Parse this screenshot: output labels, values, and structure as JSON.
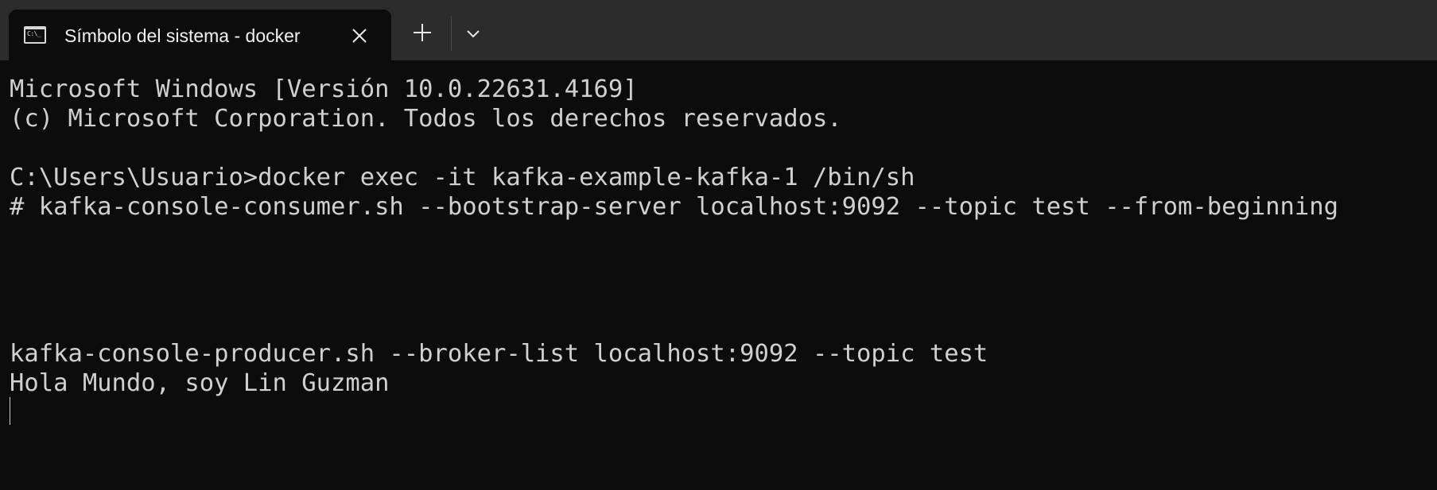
{
  "tab": {
    "title": "Símbolo del sistema - docker",
    "icon": "cmd-prompt-icon",
    "icon_text": "C:\\_"
  },
  "controls": {
    "close_icon": "close-icon",
    "new_tab_icon": "plus-icon",
    "dropdown_icon": "chevron-down-icon"
  },
  "terminal": {
    "lines": [
      "Microsoft Windows [Versión 10.0.22631.4169]",
      "(c) Microsoft Corporation. Todos los derechos reservados.",
      "",
      "C:\\Users\\Usuario>docker exec -it kafka-example-kafka-1 /bin/sh",
      "# kafka-console-consumer.sh --bootstrap-server localhost:9092 --topic test --from-beginning",
      "",
      "",
      "",
      "",
      "kafka-console-producer.sh --broker-list localhost:9092 --topic test",
      "Hola Mundo, soy Lin Guzman"
    ]
  },
  "colors": {
    "background": "#0c0c0c",
    "tabbar": "#2c2c2c",
    "text": "#d0d0d0"
  }
}
